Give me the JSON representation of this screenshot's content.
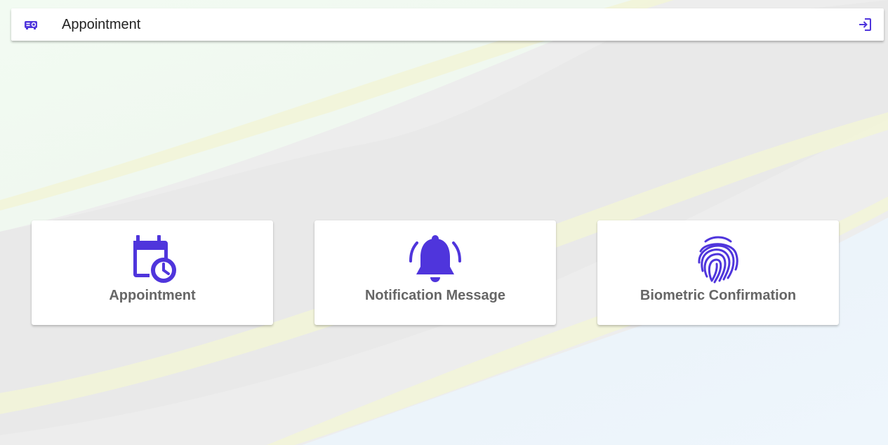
{
  "header": {
    "title": "Appointment",
    "brand_icon": "projector-icon",
    "logout_icon": "logout-icon"
  },
  "cards": [
    {
      "label": "Appointment",
      "icon": "calendar-clock-icon"
    },
    {
      "label": "Notification Message",
      "icon": "bell-ringing-icon"
    },
    {
      "label": "Biometric Confirmation",
      "icon": "fingerprint-icon"
    }
  ],
  "colors": {
    "accent": "#4f35dc",
    "card_text": "#666666",
    "background": "#ececec"
  }
}
